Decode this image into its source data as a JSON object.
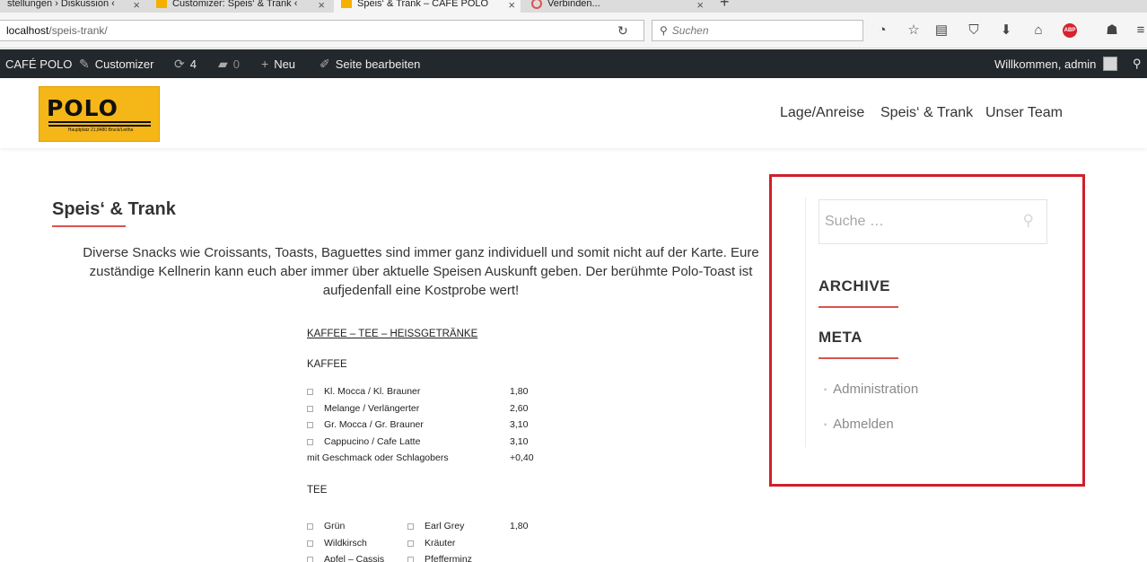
{
  "browser": {
    "tabs": [
      {
        "label": "stellungen › Diskussion ‹"
      },
      {
        "label": "Customizer: Speis‘ & Trank ‹"
      },
      {
        "label": "Speis‘ & Trank – CAFÉ POLO"
      },
      {
        "label": "Verbinden..."
      }
    ],
    "close_glyph": "×",
    "new_tab_glyph": "+",
    "url_host": "localhost",
    "url_path": "/speis-trank/",
    "search_placeholder": "Suchen",
    "toolbar_icons": [
      "history-icon",
      "star-icon",
      "clipboard-icon",
      "pocket-icon",
      "download-icon",
      "home-icon",
      "adblock-icon",
      "extension-icon",
      "menu-icon"
    ],
    "adblock_label": "ABP"
  },
  "adminbar": {
    "site_name": "CAFÉ POLO",
    "customizer": "Customizer",
    "updates_count": "4",
    "comments_count": "0",
    "new_label": "Neu",
    "edit_label": "Seite bearbeiten",
    "welcome": "Willkommen, admin"
  },
  "header": {
    "logo_text": "POLO",
    "logo_address": "Hauptplatz 21,8480 Bruck/Leitha",
    "menu": [
      {
        "label": "Lage/Anreise"
      },
      {
        "label": "Speis‘ & Trank"
      },
      {
        "label": "Unser Team"
      }
    ]
  },
  "content": {
    "title": "Speis‘ & Trank",
    "intro_1": "Diverse Snacks wie Croissants, Toasts, Baguettes sind immer ganz individuell und somit nicht auf der Karte. Eure",
    "intro_2": "zuständige Kellnerin kann euch aber immer über aktuelle Speisen Auskunft geben. Der berühmte Polo-Toast ist",
    "intro_3": "aufjedenfall eine Kostprobe wert!",
    "menu_card": {
      "heading": "KAFFEE – TEE – HEISSGETRÄNKE",
      "kaffee_label": "KAFFEE",
      "kaffee_items": [
        {
          "name": "Kl. Mocca / Kl. Brauner",
          "price": "1,80"
        },
        {
          "name": "Melange / Verlängerter",
          "price": "2,60"
        },
        {
          "name": "Gr. Mocca / Gr. Brauner",
          "price": "3,10"
        },
        {
          "name": "Cappucino / Cafe Latte",
          "price": "3,10"
        }
      ],
      "extra": {
        "name": "mit Geschmack oder Schlagobers",
        "price": "+0,40"
      },
      "tee_label": "TEE",
      "tee_rows": [
        {
          "left": "Grün",
          "right": "Earl Grey",
          "price": "1,80"
        },
        {
          "left": "Wildkirsch",
          "right": "Kräuter",
          "price": ""
        },
        {
          "left": "Apfel – Cassis",
          "right": "Pfefferminz",
          "price": ""
        }
      ]
    }
  },
  "sidebar": {
    "search_placeholder": "Suche …",
    "archive_title": "ARCHIVE",
    "meta_title": "META",
    "meta_links": [
      {
        "label": "Administration"
      },
      {
        "label": "Abmelden"
      }
    ]
  },
  "colors": {
    "accent": "#d9534f",
    "highlight_box": "#d0202b",
    "adminbar_bg": "#23282d",
    "logo_bg": "#f5b617"
  }
}
